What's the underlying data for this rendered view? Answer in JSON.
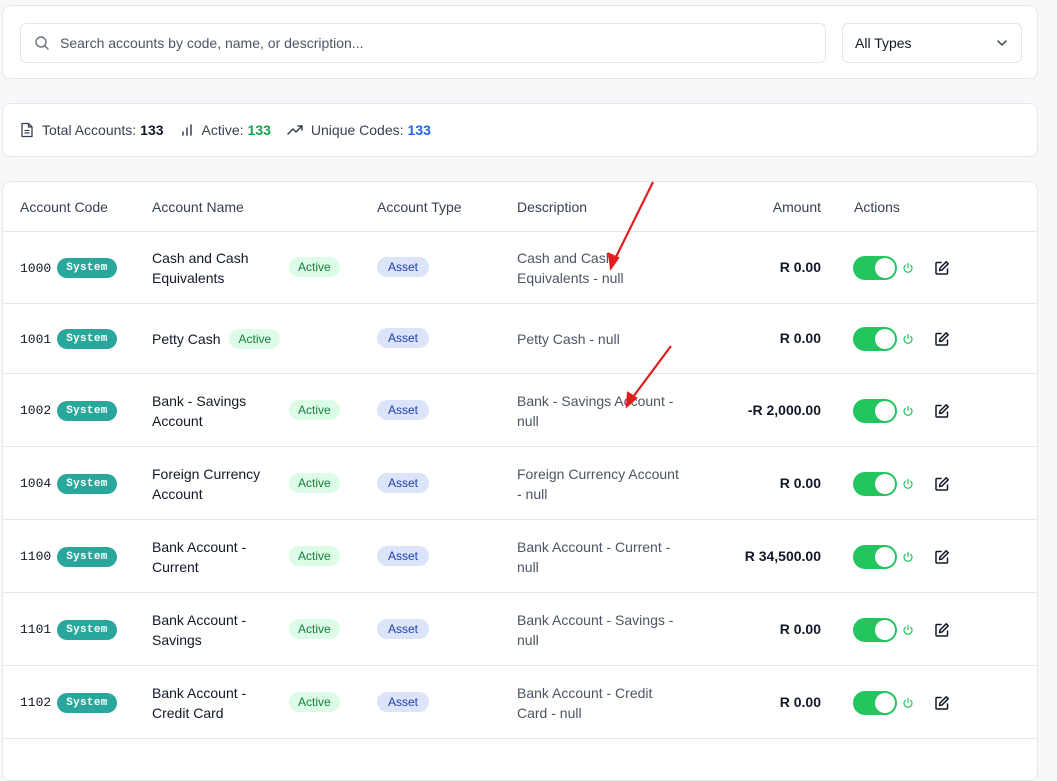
{
  "search": {
    "placeholder": "Search accounts by code, name, or description...",
    "type_filter": "All Types"
  },
  "stats": {
    "total_label": "Total Accounts:",
    "total_value": "133",
    "active_label": "Active:",
    "active_value": "133",
    "unique_label": "Unique Codes:",
    "unique_value": "133"
  },
  "table": {
    "headers": {
      "code": "Account Code",
      "name": "Account Name",
      "type": "Account Type",
      "description": "Description",
      "amount": "Amount",
      "actions": "Actions"
    },
    "rows": [
      {
        "code": "1000",
        "badge": "System",
        "name": "Cash and Cash Equivalents",
        "status": "Active",
        "type": "Asset",
        "description": "Cash and Cash Equivalents - null",
        "amount": "R 0.00"
      },
      {
        "code": "1001",
        "badge": "System",
        "name": "Petty Cash",
        "status": "Active",
        "type": "Asset",
        "description": "Petty Cash - null",
        "amount": "R 0.00"
      },
      {
        "code": "1002",
        "badge": "System",
        "name": "Bank - Savings Account",
        "status": "Active",
        "type": "Asset",
        "description": "Bank - Savings Account - null",
        "amount": "-R 2,000.00"
      },
      {
        "code": "1004",
        "badge": "System",
        "name": "Foreign Currency Account",
        "status": "Active",
        "type": "Asset",
        "description": "Foreign Currency Account - null",
        "amount": "R 0.00"
      },
      {
        "code": "1100",
        "badge": "System",
        "name": "Bank Account - Current",
        "status": "Active",
        "type": "Asset",
        "description": "Bank Account - Current - null",
        "amount": "R 34,500.00"
      },
      {
        "code": "1101",
        "badge": "System",
        "name": "Bank Account - Savings",
        "status": "Active",
        "type": "Asset",
        "description": "Bank Account - Savings - null",
        "amount": "R 0.00"
      },
      {
        "code": "1102",
        "badge": "System",
        "name": "Bank Account - Credit Card",
        "status": "Active",
        "type": "Asset",
        "description": "Bank Account - Credit Card - null",
        "amount": "R 0.00"
      }
    ]
  },
  "colors": {
    "system_badge": "#2aa79c",
    "active_green": "#16a34a",
    "toggle_on": "#22c55e",
    "annotation_arrow": "#e11d1d"
  }
}
